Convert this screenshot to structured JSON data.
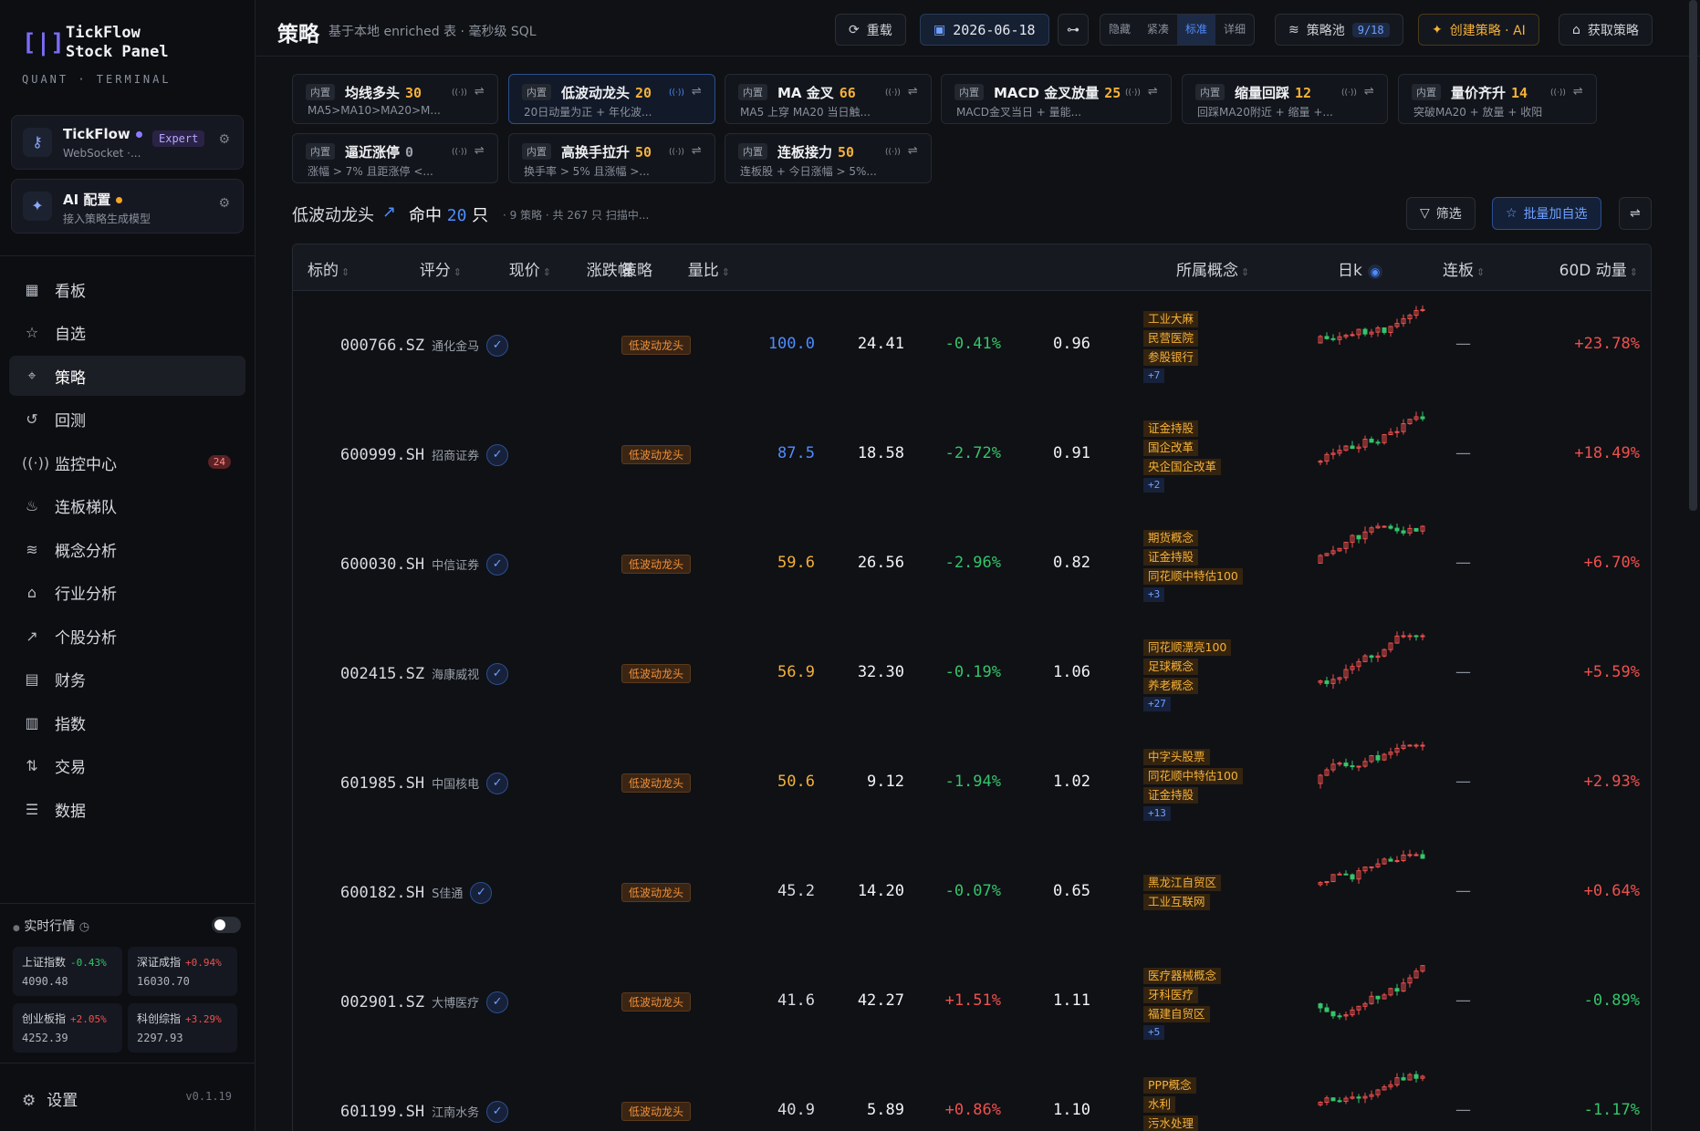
{
  "app": {
    "logo_glyph": "[|]",
    "name": "TickFlow\nStock Panel",
    "tagline": "QUANT · TERMINAL",
    "version": "v0.1.19"
  },
  "accounts": [
    {
      "title": "TickFlow",
      "sub": "WebSocket ·...",
      "badge": "Expert",
      "dot_color": "#8b7cff",
      "icon": "key-icon"
    },
    {
      "title": "AI 配置",
      "sub": "接入策略生成模型",
      "badge": "",
      "dot_color": "#f5a524",
      "icon": "sparkle-icon"
    }
  ],
  "nav": [
    {
      "label": "看板",
      "icon": "▦",
      "active": false
    },
    {
      "label": "自选",
      "icon": "☆",
      "active": false
    },
    {
      "label": "策略",
      "icon": "⌖",
      "active": true
    },
    {
      "label": "回测",
      "icon": "↺",
      "active": false
    },
    {
      "label": "监控中心",
      "icon": "((·))",
      "active": false,
      "badge": "24"
    },
    {
      "label": "连板梯队",
      "icon": "♨",
      "active": false
    },
    {
      "label": "概念分析",
      "icon": "≋",
      "active": false
    },
    {
      "label": "行业分析",
      "icon": "⌂",
      "active": false
    },
    {
      "label": "个股分析",
      "icon": "↗",
      "active": false
    },
    {
      "label": "财务",
      "icon": "▤",
      "active": false
    },
    {
      "label": "指数",
      "icon": "▥",
      "active": false
    },
    {
      "label": "交易",
      "icon": "⇅",
      "active": false
    },
    {
      "label": "数据",
      "icon": "☰",
      "active": false
    }
  ],
  "live": {
    "label": "实时行情",
    "enabled": true
  },
  "indices": [
    {
      "name": "上证指数",
      "chg": "-0.43%",
      "dir": "down",
      "val": "4090.48"
    },
    {
      "name": "深证成指",
      "chg": "+0.94%",
      "dir": "up",
      "val": "16030.70"
    },
    {
      "name": "创业板指",
      "chg": "+2.05%",
      "dir": "up",
      "val": "4252.39"
    },
    {
      "name": "科创综指",
      "chg": "+3.29%",
      "dir": "up",
      "val": "2297.93"
    }
  ],
  "settings_label": "设置",
  "header": {
    "title": "策略",
    "subtitle": "基于本地 enriched 表 · 毫秒级 SQL",
    "reload": "重载",
    "date": "2026-06-18",
    "density": [
      "隐藏",
      "紧凑",
      "标准",
      "详细"
    ],
    "density_selected": "标准",
    "pool_label": "策略池",
    "pool_count": "9/18",
    "create": "创建策略 · AI",
    "fetch": "获取策略"
  },
  "strategy_cards": [
    {
      "tag": "内置",
      "name": "均线多头",
      "count": "30",
      "desc": "MA5>MA10>MA20>M...",
      "active": false
    },
    {
      "tag": "内置",
      "name": "低波动龙头",
      "count": "20",
      "desc": "20日动量为正 + 年化波...",
      "active": true
    },
    {
      "tag": "内置",
      "name": "MA 金叉",
      "count": "66",
      "desc": "MA5 上穿 MA20 当日触...",
      "active": false
    },
    {
      "tag": "内置",
      "name": "MACD 金叉放量",
      "count": "25",
      "desc": "MACD金叉当日 + 量能...",
      "active": false
    },
    {
      "tag": "内置",
      "name": "缩量回踩",
      "count": "12",
      "desc": "回踩MA20附近 + 缩量 +...",
      "active": false
    },
    {
      "tag": "内置",
      "name": "量价齐升",
      "count": "14",
      "desc": "突破MA20 + 放量 + 收阳",
      "active": false
    },
    {
      "tag": "内置",
      "name": "逼近涨停",
      "count": "0",
      "desc": "涨幅 > 7% 且距涨停 <...",
      "active": false
    },
    {
      "tag": "内置",
      "name": "高换手拉升",
      "count": "50",
      "desc": "换手率 > 5% 且涨幅 >...",
      "active": false
    },
    {
      "tag": "内置",
      "name": "连板接力",
      "count": "50",
      "desc": "连板股 + 今日涨幅 > 5%...",
      "active": false
    }
  ],
  "result": {
    "strategy": "低波动龙头",
    "hit_prefix": "命中",
    "hit_count": "20",
    "hit_unit": "只",
    "meta": "· 9 策略 · 共 267 只   扫描中...",
    "filter": "筛选",
    "batch_add": "批量加自选"
  },
  "table": {
    "columns": [
      "标的",
      "策略",
      "评分",
      "现价",
      "涨跌幅",
      "量比",
      "所属概念",
      "日k",
      "连板",
      "60D 动量"
    ],
    "rows": [
      {
        "code": "000766.SZ",
        "name": "通化金马",
        "strategy": "低波动龙头",
        "score": "100.0",
        "score_style": "blue",
        "price": "24.41",
        "chg": "-0.41%",
        "chg_dir": "down",
        "vol_ratio": "0.96",
        "concepts": [
          "工业大麻",
          "民营医院",
          "参股银行"
        ],
        "more": "+7",
        "streak": "—",
        "mom": "+23.78%",
        "mom_dir": "up"
      },
      {
        "code": "600999.SH",
        "name": "招商证券",
        "strategy": "低波动龙头",
        "score": "87.5",
        "score_style": "blue",
        "price": "18.58",
        "chg": "-2.72%",
        "chg_dir": "down",
        "vol_ratio": "0.91",
        "concepts": [
          "证金持股",
          "国企改革",
          "央企国企改革"
        ],
        "more": "+2",
        "streak": "—",
        "mom": "+18.49%",
        "mom_dir": "up"
      },
      {
        "code": "600030.SH",
        "name": "中信证券",
        "strategy": "低波动龙头",
        "score": "59.6",
        "score_style": "orange",
        "price": "26.56",
        "chg": "-2.96%",
        "chg_dir": "down",
        "vol_ratio": "0.82",
        "concepts": [
          "期货概念",
          "证金持股",
          "同花顺中特估100"
        ],
        "more": "+3",
        "streak": "—",
        "mom": "+6.70%",
        "mom_dir": "up"
      },
      {
        "code": "002415.SZ",
        "name": "海康威视",
        "strategy": "低波动龙头",
        "score": "56.9",
        "score_style": "orange",
        "price": "32.30",
        "chg": "-0.19%",
        "chg_dir": "down",
        "vol_ratio": "1.06",
        "concepts": [
          "同花顺漂亮100",
          "足球概念",
          "养老概念"
        ],
        "more": "+27",
        "streak": "—",
        "mom": "+5.59%",
        "mom_dir": "up"
      },
      {
        "code": "601985.SH",
        "name": "中国核电",
        "strategy": "低波动龙头",
        "score": "50.6",
        "score_style": "orange",
        "price": "9.12",
        "chg": "-1.94%",
        "chg_dir": "down",
        "vol_ratio": "1.02",
        "concepts": [
          "中字头股票",
          "同花顺中特估100",
          "证金持股"
        ],
        "more": "+13",
        "streak": "—",
        "mom": "+2.93%",
        "mom_dir": "up"
      },
      {
        "code": "600182.SH",
        "name": "S佳通",
        "strategy": "低波动龙头",
        "score": "45.2",
        "score_style": "plain",
        "price": "14.20",
        "chg": "-0.07%",
        "chg_dir": "down",
        "vol_ratio": "0.65",
        "concepts": [
          "黑龙江自贸区",
          "工业互联网"
        ],
        "more": "",
        "streak": "—",
        "mom": "+0.64%",
        "mom_dir": "up"
      },
      {
        "code": "002901.SZ",
        "name": "大博医疗",
        "strategy": "低波动龙头",
        "score": "41.6",
        "score_style": "plain",
        "price": "42.27",
        "chg": "+1.51%",
        "chg_dir": "up",
        "vol_ratio": "1.11",
        "concepts": [
          "医疗器械概念",
          "牙科医疗",
          "福建自贸区"
        ],
        "more": "+5",
        "streak": "—",
        "mom": "-0.89%",
        "mom_dir": "down"
      },
      {
        "code": "601199.SH",
        "name": "江南水务",
        "strategy": "低波动龙头",
        "score": "40.9",
        "score_style": "plain",
        "price": "5.89",
        "chg": "+0.86%",
        "chg_dir": "up",
        "vol_ratio": "1.10",
        "concepts": [
          "PPP概念",
          "水利",
          "污水处理"
        ],
        "more": "",
        "streak": "—",
        "mom": "-1.17%",
        "mom_dir": "down"
      }
    ]
  },
  "colors": {
    "up": "#f0504d",
    "down": "#35c46a",
    "accent": "#4f8cff",
    "warn": "#f5b13a"
  }
}
